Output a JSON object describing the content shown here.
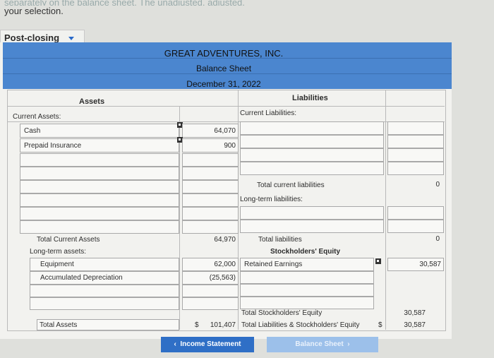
{
  "intro": {
    "line1_faded": "separately on the balance sheet. The unadjusted, adjusted,",
    "line2": "your selection."
  },
  "selector": {
    "value": "Post-closing"
  },
  "header": {
    "company": "GREAT ADVENTURES, INC.",
    "statement": "Balance Sheet",
    "date": "December 31, 2022"
  },
  "columns": {
    "assets": "Assets",
    "liabilities": "Liabilities"
  },
  "left": {
    "current_assets": "Current Assets:",
    "cash": "Cash",
    "cash_dollar": "$",
    "cash_value": "64,070",
    "prepaid": "Prepaid Insurance",
    "prepaid_value": "900",
    "total_current": "Total Current Assets",
    "total_current_value": "64,970",
    "long_term": "Long-term assets:",
    "equipment": "Equipment",
    "equipment_value": "62,000",
    "accum_dep": "Accumulated Depreciation",
    "accum_dep_value": "(25,563)",
    "total_assets": "Total Assets",
    "total_assets_dollar": "$",
    "total_assets_value": "101,407"
  },
  "right": {
    "current_liab": "Current Liabilities:",
    "total_current_liab": "Total current liabilities",
    "total_current_liab_value": "0",
    "long_term_liab": "Long-term liabilities:",
    "total_liab": "Total liabilities",
    "total_liab_value": "0",
    "equity": "Stockholders' Equity",
    "retained": "Retained Earnings",
    "retained_value": "30,587",
    "total_equity": "Total Stockholders' Equity",
    "total_equity_value": "30,587",
    "total_le": "Total Liabilities & Stockholders' Equity",
    "total_le_dollar": "$",
    "total_le_value": "30,587"
  },
  "nav": {
    "prev_label": "Income Statement",
    "next_label": "Balance Sheet"
  },
  "colors": {
    "header_blue": "#4b86cf",
    "button_blue": "#2f6fc6",
    "button_disabled": "#9cc0ea"
  }
}
